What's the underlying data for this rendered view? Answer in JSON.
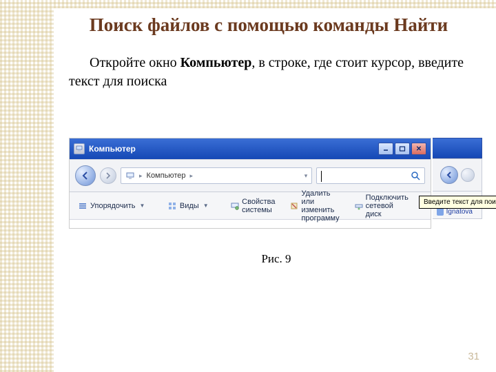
{
  "slide": {
    "heading": "Поиск файлов с помощью команды Найти",
    "para_prefix": "Откройте  окно ",
    "para_bold": "Компьютер",
    "para_suffix": ", в строке,  где стоит курсор, введите текст для поиска",
    "figure_caption": "Рис. 9",
    "page_number": "31"
  },
  "window": {
    "title": "Компьютер",
    "breadcrumb_label": "Компьютер",
    "toolbar": {
      "organize": "Упорядочить",
      "views": "Виды",
      "system_props": "Свойства системы",
      "uninstall": "Удалить или изменить программу",
      "map_drive": "Подключить сетевой диск",
      "overflow": "»"
    },
    "tooltip": "Введите текст для поиска в текущем отображении",
    "rpanel_link": "(F:) Ignatova"
  }
}
